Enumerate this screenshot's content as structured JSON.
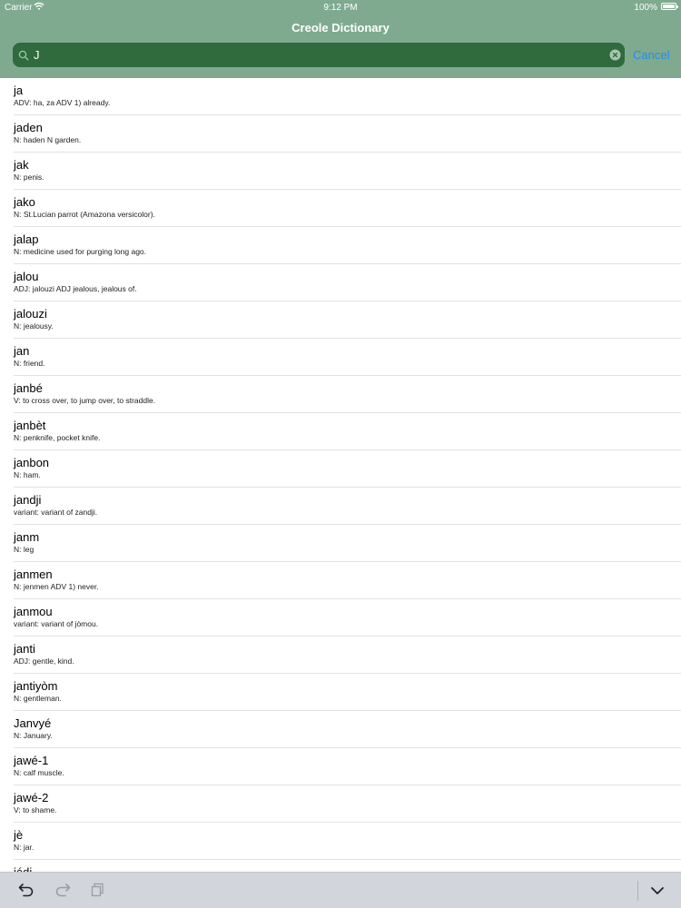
{
  "status_bar": {
    "carrier": "Carrier",
    "time": "9:12 PM",
    "battery": "100%"
  },
  "header": {
    "title": "Creole Dictionary"
  },
  "search": {
    "value": "J",
    "cancel_label": "Cancel"
  },
  "entries": [
    {
      "word": "ja",
      "definition": "ADV:  ha, za ADV 1) already."
    },
    {
      "word": "jaden",
      "definition": "N:  haden N garden."
    },
    {
      "word": "jak",
      "definition": "N:  penis."
    },
    {
      "word": "jako",
      "definition": "N:  St.Lucian parrot (Amazona versicolor)."
    },
    {
      "word": "jalap",
      "definition": "N:  medicine used for purging long ago."
    },
    {
      "word": "jalou",
      "definition": "ADJ:  jalouzi ADJ jealous, jealous of."
    },
    {
      "word": "jalouzi",
      "definition": "N:  jealousy."
    },
    {
      "word": "jan",
      "definition": "N:  friend."
    },
    {
      "word": "janbé",
      "definition": "V:  to cross over, to jump over, to straddle."
    },
    {
      "word": "janbèt",
      "definition": "N:  penknife, pocket knife."
    },
    {
      "word": "janbon",
      "definition": "N:  ham."
    },
    {
      "word": "jandji",
      "definition": "variant:  variant of zandji."
    },
    {
      "word": "janm",
      "definition": "N:  leg"
    },
    {
      "word": "janmen",
      "definition": "N:  jenmen ADV 1) never."
    },
    {
      "word": "janmou",
      "definition": "variant:  variant of jòmou."
    },
    {
      "word": "janti",
      "definition": "ADJ:  gentle, kind."
    },
    {
      "word": "jantiyòm",
      "definition": "N:  gentleman."
    },
    {
      "word": "Janvyé",
      "definition": "N:  January."
    },
    {
      "word": "jawé-1",
      "definition": "N:  calf muscle."
    },
    {
      "word": "jawé-2",
      "definition": "V:  to shame."
    },
    {
      "word": "jè",
      "definition": "N:  jar."
    },
    {
      "word": "jédi",
      "definition": ""
    }
  ],
  "icons": {
    "wifi": "wifi-icon",
    "battery": "battery-icon",
    "search": "search-icon",
    "clear": "clear-icon",
    "undo": "undo-icon",
    "redo": "redo-icon",
    "paste": "paste-icon",
    "dismiss": "chevron-down-icon"
  },
  "colors": {
    "header": "#7faa90",
    "search_field": "#2f6b3d",
    "cancel": "#1e8ff0",
    "toolbar": "#d2d5db"
  }
}
